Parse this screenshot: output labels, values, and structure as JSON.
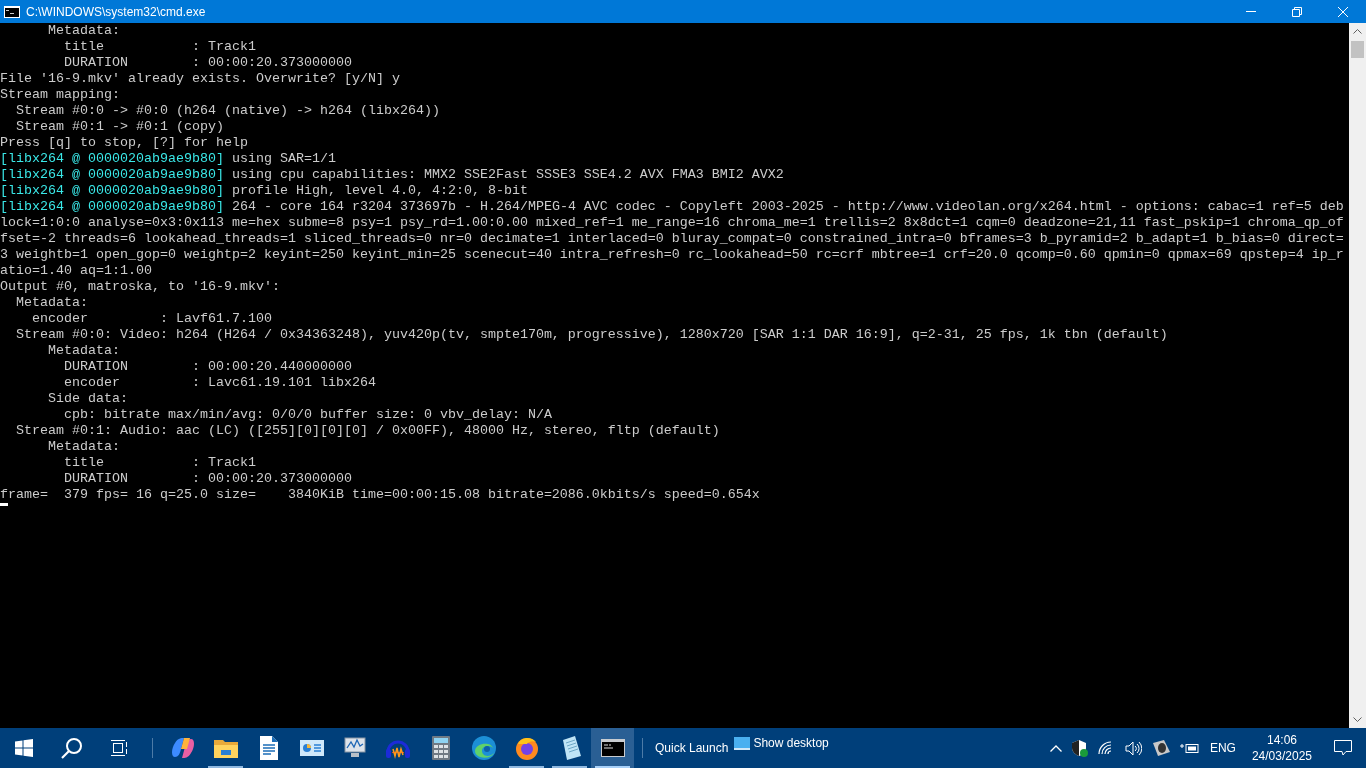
{
  "window": {
    "title": "C:\\WINDOWS\\system32\\cmd.exe"
  },
  "console": {
    "lines": [
      {
        "text": "      Metadata:"
      },
      {
        "text": "        title           : Track1"
      },
      {
        "text": "        DURATION        : 00:00:20.373000000"
      },
      {
        "text": "File '16-9.mkv' already exists. Overwrite? [y/N] y"
      },
      {
        "text": "Stream mapping:"
      },
      {
        "text": "  Stream #0:0 -> #0:0 (h264 (native) -> h264 (libx264))"
      },
      {
        "text": "  Stream #0:1 -> #0:1 (copy)"
      },
      {
        "text": "Press [q] to stop, [?] for help"
      },
      {
        "prefix": "[libx264 @ 0000020ab9ae9b80]",
        "text": " using SAR=1/1"
      },
      {
        "prefix": "[libx264 @ 0000020ab9ae9b80]",
        "text": " using cpu capabilities: MMX2 SSE2Fast SSSE3 SSE4.2 AVX FMA3 BMI2 AVX2"
      },
      {
        "prefix": "[libx264 @ 0000020ab9ae9b80]",
        "text": " profile High, level 4.0, 4:2:0, 8-bit"
      },
      {
        "prefix": "[libx264 @ 0000020ab9ae9b80]",
        "text": " 264 - core 164 r3204 373697b - H.264/MPEG-4 AVC codec - Copyleft 2003-2025 - http://www.videolan.org/x264.html - options: cabac=1 ref=5 deb"
      },
      {
        "text": "lock=1:0:0 analyse=0x3:0x113 me=hex subme=8 psy=1 psy_rd=1.00:0.00 mixed_ref=1 me_range=16 chroma_me=1 trellis=2 8x8dct=1 cqm=0 deadzone=21,11 fast_pskip=1 chroma_qp_of"
      },
      {
        "text": "fset=-2 threads=6 lookahead_threads=1 sliced_threads=0 nr=0 decimate=1 interlaced=0 bluray_compat=0 constrained_intra=0 bframes=3 b_pyramid=2 b_adapt=1 b_bias=0 direct="
      },
      {
        "text": "3 weightb=1 open_gop=0 weightp=2 keyint=250 keyint_min=25 scenecut=40 intra_refresh=0 rc_lookahead=50 rc=crf mbtree=1 crf=20.0 qcomp=0.60 qpmin=0 qpmax=69 qpstep=4 ip_r"
      },
      {
        "text": "atio=1.40 aq=1:1.00"
      },
      {
        "text": "Output #0, matroska, to '16-9.mkv':"
      },
      {
        "text": "  Metadata:"
      },
      {
        "text": "    encoder         : Lavf61.7.100"
      },
      {
        "text": "  Stream #0:0: Video: h264 (H264 / 0x34363248), yuv420p(tv, smpte170m, progressive), 1280x720 [SAR 1:1 DAR 16:9], q=2-31, 25 fps, 1k tbn (default)"
      },
      {
        "text": "      Metadata:"
      },
      {
        "text": "        DURATION        : 00:00:20.440000000"
      },
      {
        "text": "        encoder         : Lavc61.19.101 libx264"
      },
      {
        "text": "      Side data:"
      },
      {
        "text": "        cpb: bitrate max/min/avg: 0/0/0 buffer size: 0 vbv_delay: N/A"
      },
      {
        "text": "  Stream #0:1: Audio: aac (LC) ([255][0][0][0] / 0x00FF), 48000 Hz, stereo, fltp (default)"
      },
      {
        "text": "      Metadata:"
      },
      {
        "text": "        title           : Track1"
      },
      {
        "text": "        DURATION        : 00:00:20.373000000"
      },
      {
        "text": "frame=  379 fps= 16 q=25.0 size=    3840KiB time=00:00:15.08 bitrate=2086.0kbits/s speed=0.654x"
      }
    ]
  },
  "taskbar": {
    "apps": [
      {
        "kind": "copilot",
        "running": false,
        "selected": false
      },
      {
        "kind": "folder",
        "running": true,
        "selected": false
      },
      {
        "kind": "document",
        "running": false,
        "selected": false
      },
      {
        "kind": "panel",
        "running": false,
        "selected": false
      },
      {
        "kind": "monitor",
        "running": false,
        "selected": false
      },
      {
        "kind": "headphones",
        "running": false,
        "selected": false
      },
      {
        "kind": "calculator",
        "running": false,
        "selected": false
      },
      {
        "kind": "edge",
        "running": false,
        "selected": false
      },
      {
        "kind": "firefox",
        "running": true,
        "selected": false
      },
      {
        "kind": "notepad",
        "running": true,
        "selected": false
      },
      {
        "kind": "terminal",
        "running": true,
        "selected": true
      }
    ],
    "quick_launch": "Quick Launch",
    "show_desktop": "Show desktop",
    "language": "ENG",
    "time": "14:06",
    "date": "24/03/2025"
  }
}
